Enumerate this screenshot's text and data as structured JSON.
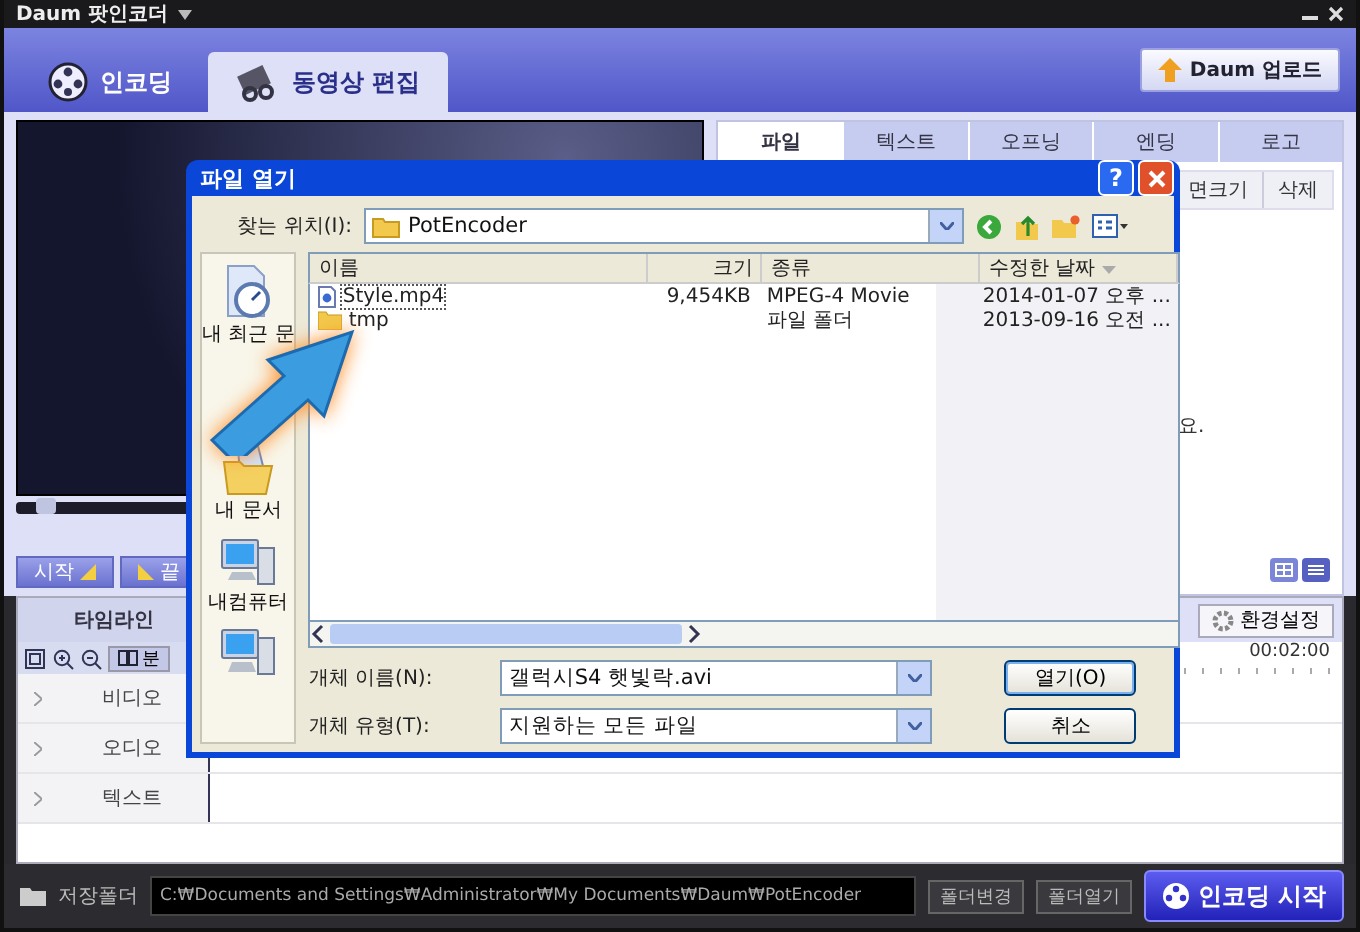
{
  "window": {
    "title": "Daum 팟인코더"
  },
  "main_tabs": [
    {
      "label": "인코딩",
      "selected": false
    },
    {
      "label": "동영상 편집",
      "selected": true
    }
  ],
  "upload_button": "Daum 업로드",
  "player": {
    "level": 0.03,
    "start_button": "시작",
    "end_button": "끝"
  },
  "edit_tabs": [
    {
      "label": "파일",
      "selected": true
    },
    {
      "label": "텍스트",
      "selected": false
    },
    {
      "label": "오프닝",
      "selected": false
    },
    {
      "label": "엔딩",
      "selected": false
    },
    {
      "label": "로고",
      "selected": false
    }
  ],
  "file_toolbar": [
    "면크기",
    "삭제"
  ],
  "hint_fragment": "요.",
  "settings_button": "환경설정",
  "timeline": {
    "title": "타임라인",
    "split_button": "분",
    "time_mark": "00:02:00",
    "tracks": [
      "비디오",
      "오디오",
      "텍스트"
    ]
  },
  "save_bar": {
    "label": "저장폴더",
    "path": "C:₩Documents and Settings₩Administrator₩My Documents₩Daum₩PotEncoder",
    "buttons": [
      "폴더변경",
      "폴더열기"
    ]
  },
  "encode_button": "인코딩 시작",
  "dialog": {
    "title": "파일 열기",
    "help_button": "?",
    "look_in_label": "찾는 위치(I):",
    "look_in": "PotEncoder",
    "places": [
      {
        "kind": "recent",
        "label": "내 최근 문"
      },
      {
        "kind": "documents",
        "label": "내 문서"
      },
      {
        "kind": "computer",
        "label": "내컴퓨터"
      },
      {
        "kind": "network"
      }
    ],
    "columns": [
      "이름",
      "크기",
      "종류",
      "수정한 날짜"
    ],
    "files": [
      {
        "kind": "video",
        "name": "Style.mp4",
        "size": "9,454KB",
        "type": "MPEG-4 Movie",
        "date": "2014-01-07 오후 ...",
        "selected": true
      },
      {
        "kind": "folder",
        "name": "tmp",
        "type": "파일 폴더",
        "date": "2013-09-16 오전 ...",
        "selected": false
      }
    ],
    "file_name_label": "개체 이름(N):",
    "file_name": "갤럭시S4 햇빛락.avi",
    "file_type_label": "개체 유형(T):",
    "file_type": "지원하는 모든 파일",
    "open_button": "열기(O)",
    "cancel_button": "취소"
  }
}
